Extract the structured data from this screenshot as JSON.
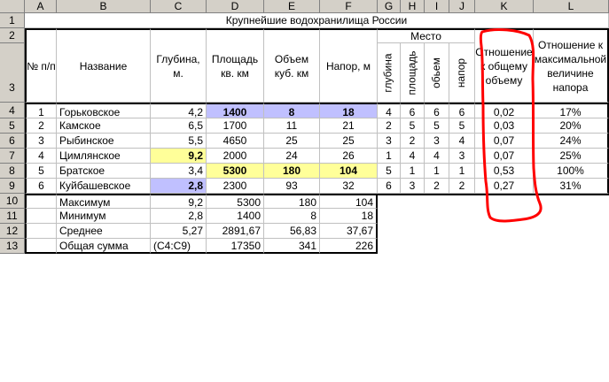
{
  "columns": [
    "A",
    "B",
    "C",
    "D",
    "E",
    "F",
    "G",
    "H",
    "I",
    "J",
    "K",
    "L"
  ],
  "rows": [
    "1",
    "2",
    "3",
    "4",
    "5",
    "6",
    "7",
    "8",
    "9",
    "10",
    "11",
    "12",
    "13"
  ],
  "title": "Крупнейшие водохранилища России",
  "headers": {
    "num": "№ п/п",
    "name": "Название",
    "depth": "Глубина, м.",
    "area": "Площадь кв. км",
    "volume": "Объем куб. км",
    "head": "Напор, м",
    "place": "Место",
    "place_depth": "глубина",
    "place_area": "площадь",
    "place_volume": "обьем",
    "place_head": "напор",
    "ratio_volume": "Отношение к общему объему",
    "ratio_head": "Отношение к максимальной величине напора"
  },
  "data": [
    {
      "n": "1",
      "name": "Горьковское",
      "depth": "4,2",
      "area": "1400",
      "volume": "8",
      "head": "18",
      "p1": "4",
      "p2": "6",
      "p3": "6",
      "p4": "6",
      "rv": "0,02",
      "rh": "17%"
    },
    {
      "n": "2",
      "name": "Камское",
      "depth": "6,5",
      "area": "1700",
      "volume": "11",
      "head": "21",
      "p1": "2",
      "p2": "5",
      "p3": "5",
      "p4": "5",
      "rv": "0,03",
      "rh": "20%"
    },
    {
      "n": "3",
      "name": "Рыбинское",
      "depth": "5,5",
      "area": "4650",
      "volume": "25",
      "head": "25",
      "p1": "3",
      "p2": "2",
      "p3": "3",
      "p4": "4",
      "rv": "0,07",
      "rh": "24%"
    },
    {
      "n": "4",
      "name": "Цимлянское",
      "depth": "9,2",
      "area": "2000",
      "volume": "24",
      "head": "26",
      "p1": "1",
      "p2": "4",
      "p3": "4",
      "p4": "3",
      "rv": "0,07",
      "rh": "25%"
    },
    {
      "n": "5",
      "name": "Братское",
      "depth": "3,4",
      "area": "5300",
      "volume": "180",
      "head": "104",
      "p1": "5",
      "p2": "1",
      "p3": "1",
      "p4": "1",
      "rv": "0,53",
      "rh": "100%"
    },
    {
      "n": "6",
      "name": "Куйбашевское",
      "depth": "2,8",
      "area": "2300",
      "volume": "93",
      "head": "32",
      "p1": "6",
      "p2": "3",
      "p3": "2",
      "p4": "2",
      "rv": "0,27",
      "rh": "31%"
    }
  ],
  "stats": [
    {
      "label": "Максимум",
      "depth": "9,2",
      "area": "5300",
      "volume": "180",
      "head": "104"
    },
    {
      "label": "Минимум",
      "depth": "2,8",
      "area": "1400",
      "volume": "8",
      "head": "18"
    },
    {
      "label": "Среднее",
      "depth": "5,27",
      "area": "2891,67",
      "volume": "56,83",
      "head": "37,67"
    },
    {
      "label": "Общая сумма",
      "depth": "(C4:C9)",
      "area": "17350",
      "volume": "341",
      "head": "226"
    }
  ],
  "colors": {
    "highlight_blue": "#c0c0ff",
    "highlight_yellow": "#ffff99",
    "annotation_red": "#ff0000",
    "header_gray": "#d4d0c8"
  }
}
